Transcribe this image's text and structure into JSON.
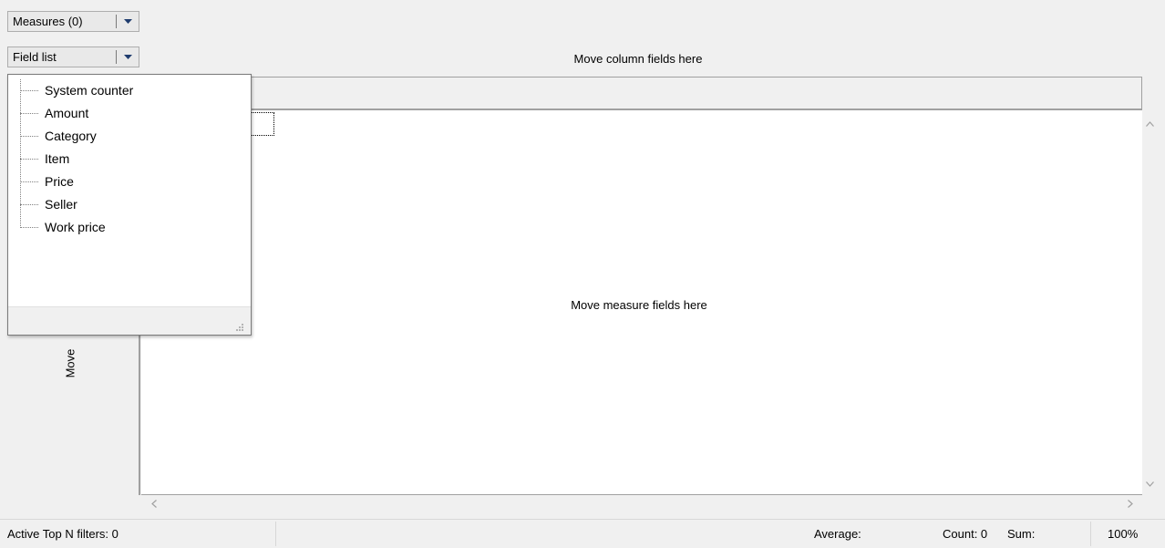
{
  "toolbar": {
    "measures_label": "Measures (0)",
    "field_list_label": "Field list"
  },
  "zones": {
    "column_zone": "Move column fields here",
    "row_zone": "Move",
    "measure_zone": "Move measure fields here"
  },
  "field_list": {
    "items": [
      {
        "label": "System counter"
      },
      {
        "label": "Amount"
      },
      {
        "label": "Category"
      },
      {
        "label": "Item"
      },
      {
        "label": "Price"
      },
      {
        "label": "Seller"
      },
      {
        "label": "Work price"
      }
    ]
  },
  "status_bar": {
    "filters": "Active Top N filters: 0",
    "average": "Average:",
    "count": "Count: 0",
    "sum": "Sum:",
    "zoom": "100%"
  },
  "colors": {
    "background": "#f0f0f0",
    "grid_background": "#ffffff",
    "border": "#a0a0a0"
  },
  "icons": {
    "dropdown": "chevron-down-icon",
    "scroll_up": "chevron-up-icon",
    "scroll_down": "chevron-down-icon",
    "scroll_left": "chevron-left-icon",
    "scroll_right": "chevron-right-icon",
    "resize": "resize-grip-icon"
  }
}
